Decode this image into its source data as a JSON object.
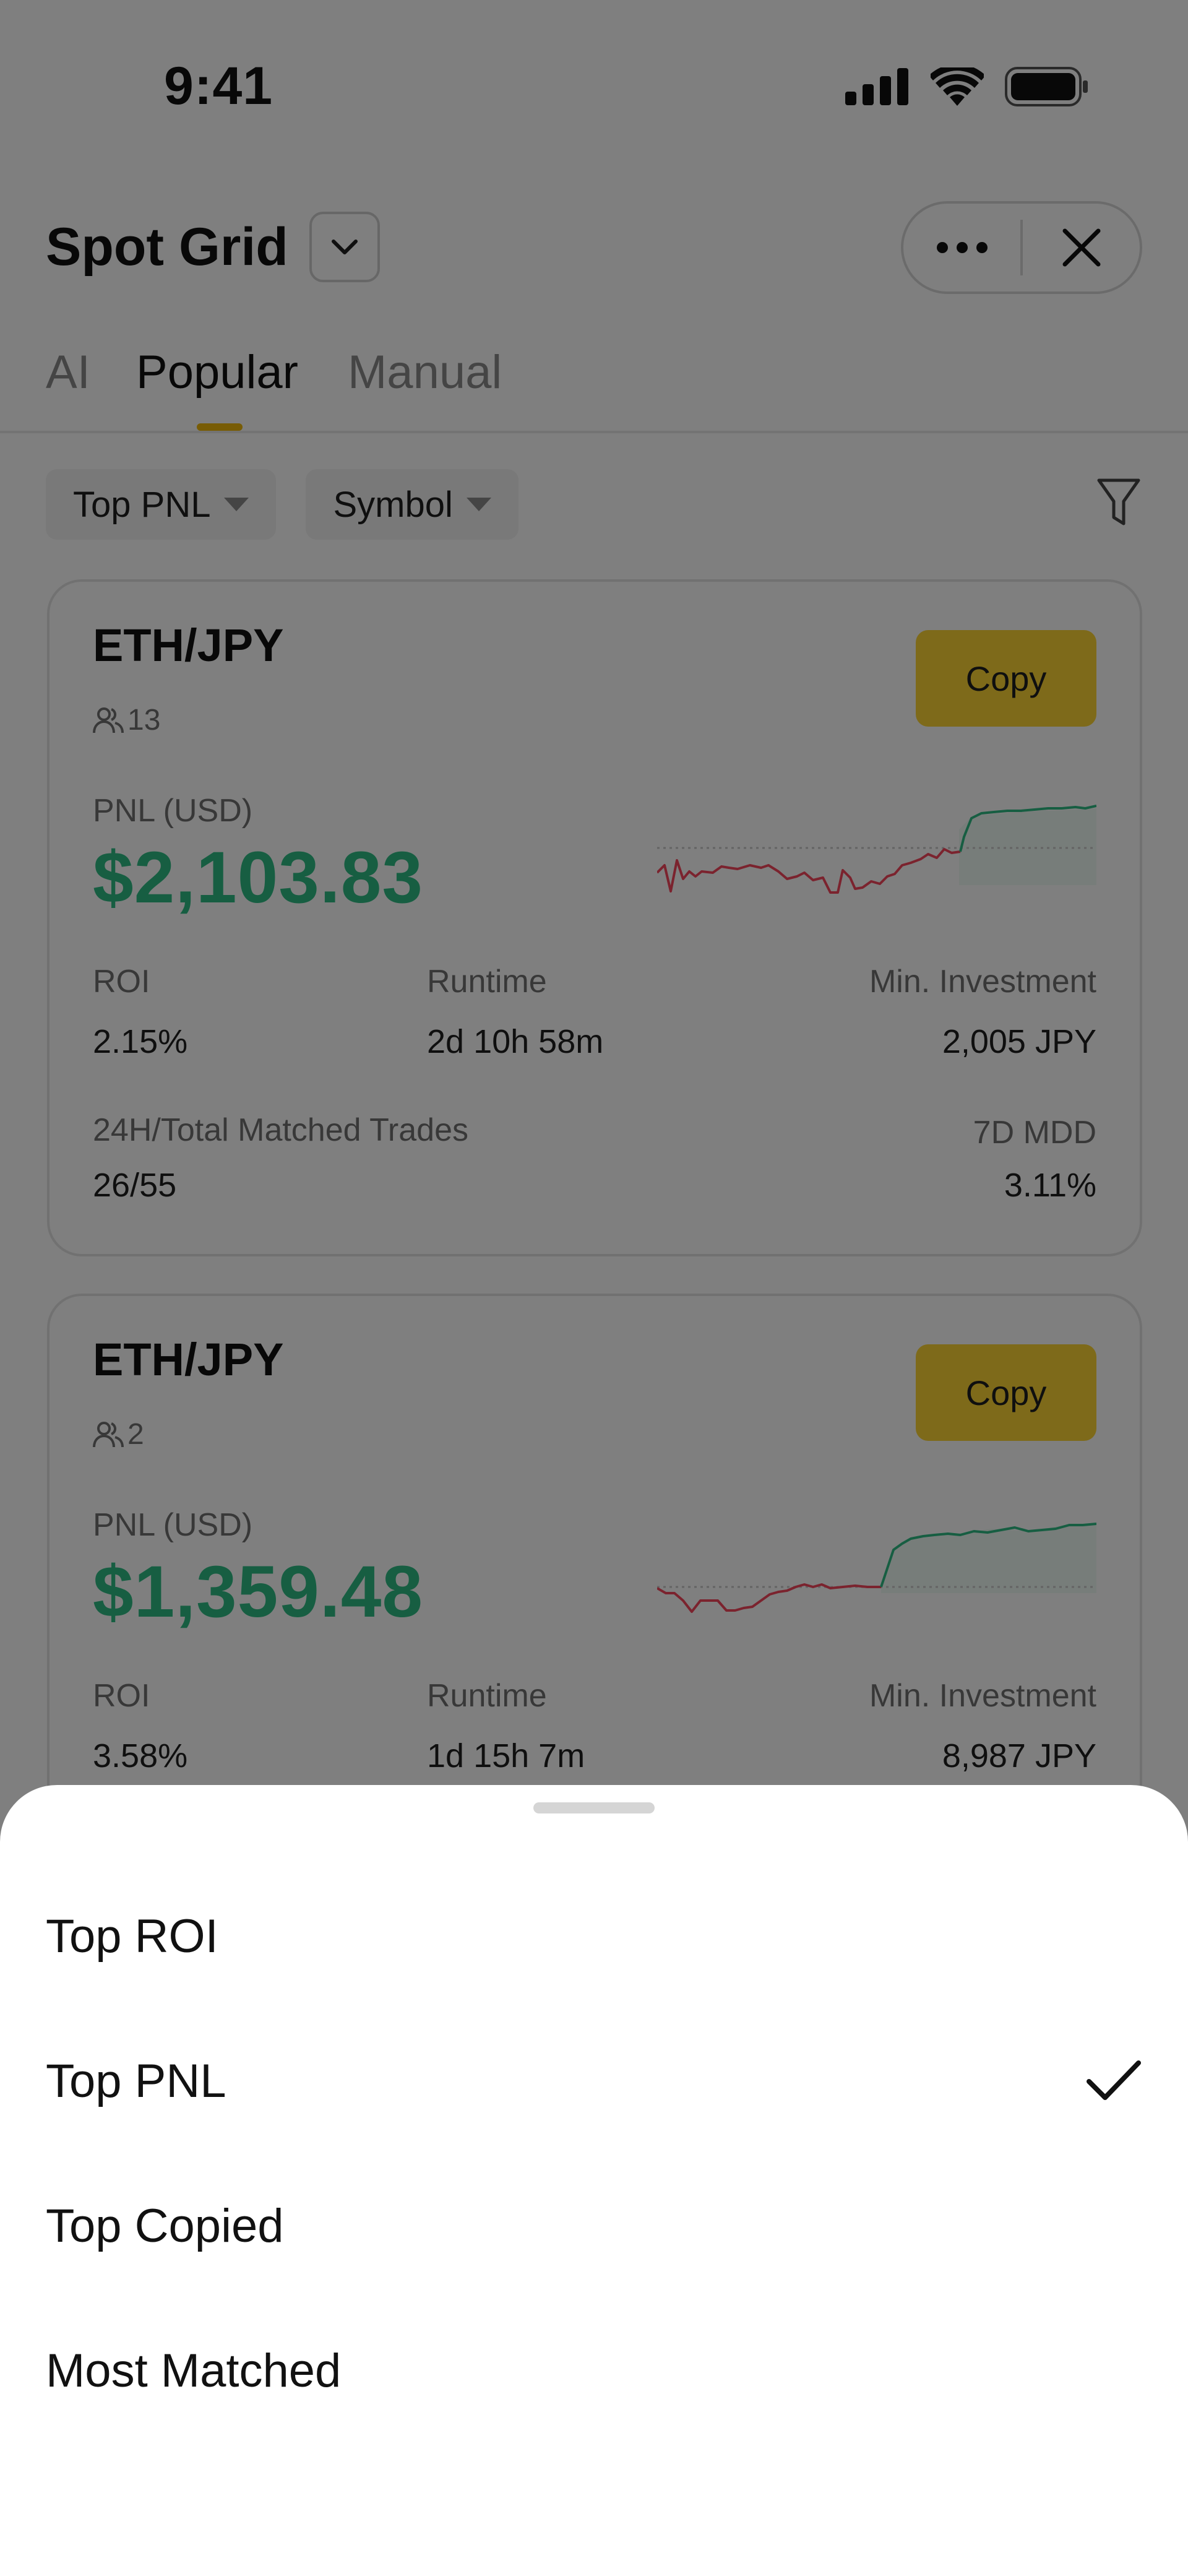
{
  "status_bar": {
    "time": "9:41"
  },
  "header": {
    "title": "Spot Grid"
  },
  "tabs": [
    {
      "label": "AI",
      "active": false
    },
    {
      "label": "Popular",
      "active": true
    },
    {
      "label": "Manual",
      "active": false
    }
  ],
  "filters": {
    "sort_label": "Top PNL",
    "symbol_label": "Symbol"
  },
  "cards": [
    {
      "pair": "ETH/JPY",
      "copiers": "13",
      "copy_label": "Copy",
      "pnl_label": "PNL (USD)",
      "pnl_value": "$2,103.83",
      "roi_label": "ROI",
      "roi_value": "2.15%",
      "runtime_label": "Runtime",
      "runtime_value": "2d 10h 58m",
      "min_invest_label": "Min. Investment",
      "min_invest_value": "2,005 JPY",
      "trades_label": "24H/Total Matched Trades",
      "trades_value": "26/55",
      "mdd_label": "7D MDD",
      "mdd_value": "3.11%"
    },
    {
      "pair": "ETH/JPY",
      "copiers": "2",
      "copy_label": "Copy",
      "pnl_label": "PNL (USD)",
      "pnl_value": "$1,359.48",
      "roi_label": "ROI",
      "roi_value": "3.58%",
      "runtime_label": "Runtime",
      "runtime_value": "1d 15h 7m",
      "min_invest_label": "Min. Investment",
      "min_invest_value": "8,987 JPY"
    }
  ],
  "sort_sheet": {
    "options": [
      {
        "label": "Top ROI",
        "selected": false
      },
      {
        "label": "Top PNL",
        "selected": true
      },
      {
        "label": "Top Copied",
        "selected": false
      },
      {
        "label": "Most Matched",
        "selected": false
      }
    ]
  },
  "colors": {
    "accent": "#fcd535",
    "profit": "#2ebd85",
    "loss": "#f6465d",
    "overlay": "rgba(0,0,0,0.5)"
  }
}
